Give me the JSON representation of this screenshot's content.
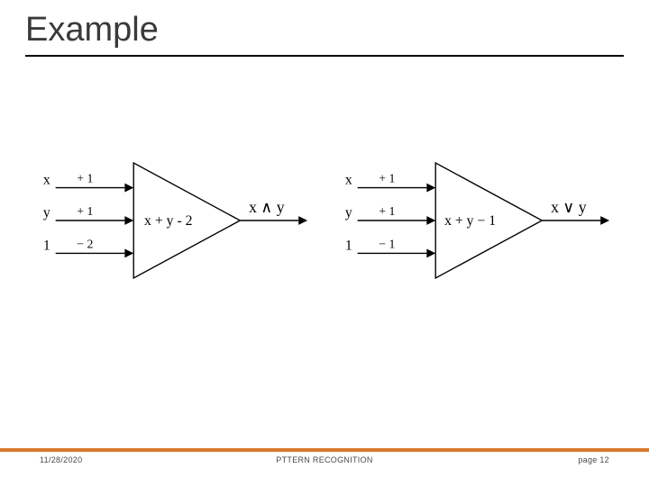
{
  "slide": {
    "title": "Example"
  },
  "diagrams": {
    "left": {
      "input1": {
        "var": "x",
        "weight": "+ 1"
      },
      "input2": {
        "var": "y",
        "weight": "+ 1"
      },
      "input3": {
        "var": "1",
        "weight": "− 2"
      },
      "center": "x + y - 2",
      "output": "x ∧ y"
    },
    "right": {
      "input1": {
        "var": "x",
        "weight": "+ 1"
      },
      "input2": {
        "var": "y",
        "weight": "+ 1"
      },
      "input3": {
        "var": "1",
        "weight": "− 1"
      },
      "center": "x + y − 1",
      "output": "x ∨ y"
    }
  },
  "footer": {
    "date": "11/28/2020",
    "center": "PTTERN RECOGNITION",
    "page_prefix": "page ",
    "page_number": "12"
  }
}
